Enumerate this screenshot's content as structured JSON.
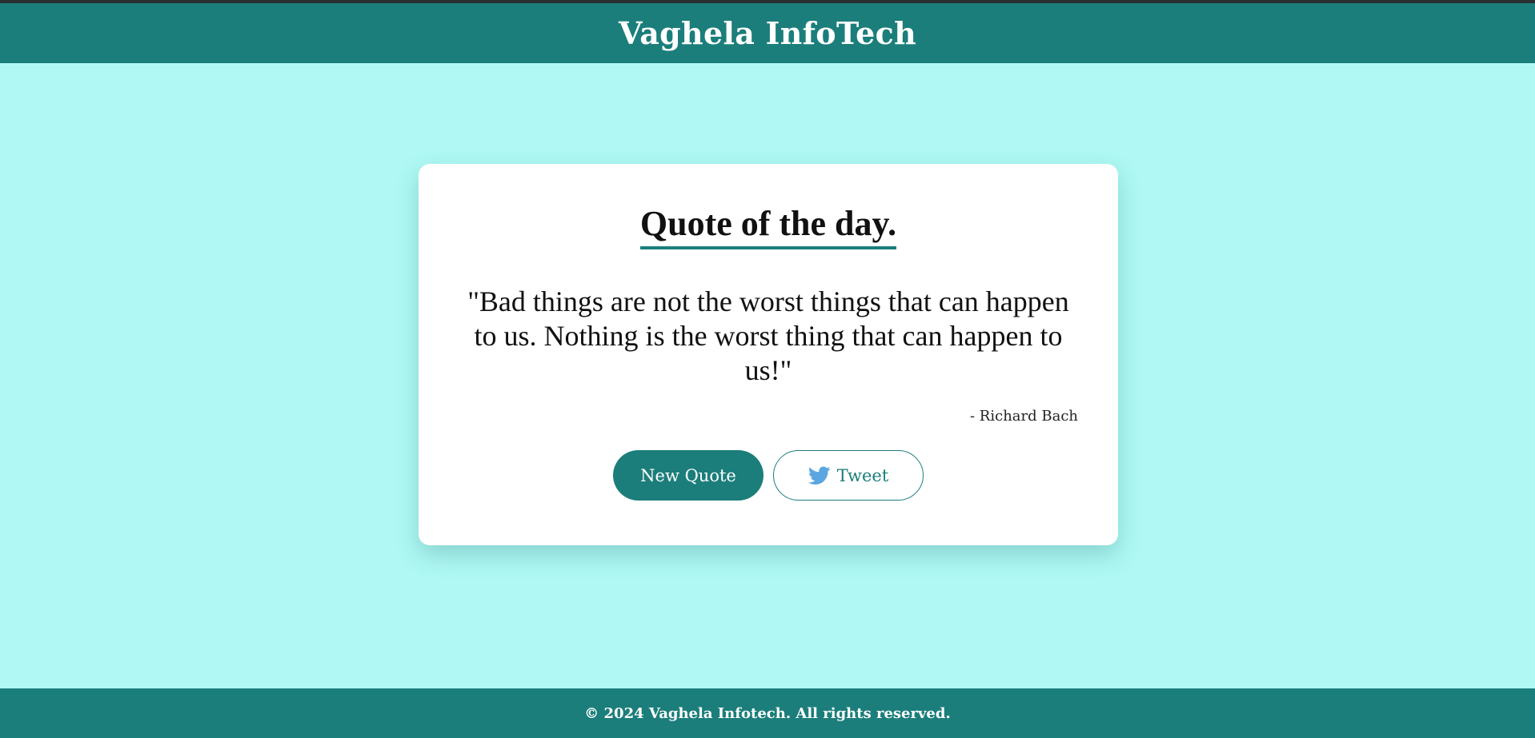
{
  "header": {
    "title": "Vaghela InfoTech"
  },
  "card": {
    "heading": "Quote of the day.",
    "quote": "\"Bad things are not the worst things that can happen to us. Nothing is the worst thing that can happen to us!\"",
    "author": "- Richard Bach",
    "buttons": {
      "new_quote": "New Quote",
      "tweet": "Tweet",
      "tweet_icon": "twitter-bird-icon"
    }
  },
  "footer": {
    "text": "© 2024 Vaghela Infotech. All rights reserved."
  },
  "colors": {
    "page_background": "#aff8f4",
    "brand_teal": "#1b7e7b",
    "card_background": "#ffffff",
    "twitter_blue": "#5aa6e0"
  }
}
